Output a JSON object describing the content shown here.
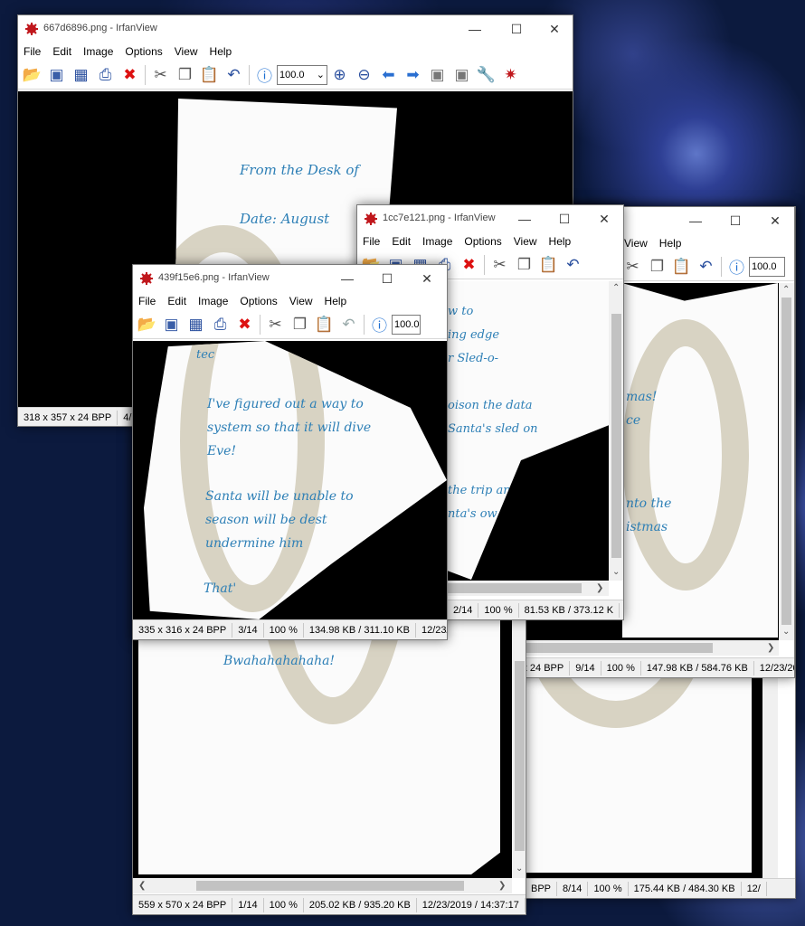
{
  "windows": {
    "w1": {
      "title": "667d6896.png - IrfanView",
      "menu": [
        "File",
        "Edit",
        "Image",
        "Options",
        "View",
        "Help"
      ],
      "zoom": "100.0",
      "text": {
        "line1": "From the Desk of",
        "line2": "Date: August"
      },
      "status": [
        "318 x 357 x 24 BPP",
        "4/14"
      ]
    },
    "w2": {
      "title": "1cc7e121.png - IrfanView",
      "menu": [
        "File",
        "Edit",
        "Image",
        "Options",
        "View",
        "Help"
      ],
      "text": {
        "l1": "w to",
        "l2": "ing edge",
        "l3": "r Sled-o-",
        "l4": "oison the data",
        "l5": "Santa's sled on",
        "l6": "the trip an",
        "l7": "nta's ow"
      },
      "status": [
        "2/14",
        "100 %",
        "81.53 KB / 373.12 K"
      ]
    },
    "w3": {
      "menu": [
        "View",
        "Help"
      ],
      "zoom": "100.0",
      "text": {
        "l1": "mas!",
        "l2": "ce",
        "l3": "nto the",
        "l4": "istmas"
      },
      "status": [
        "431 x 462 x 24 BPP",
        "9/14",
        "100 %",
        "147.98 KB / 584.76 KB",
        "12/23/20"
      ]
    },
    "w4": {
      "title": "439f15e6.png - IrfanView",
      "menu": [
        "File",
        "Edit",
        "Image",
        "Options",
        "View",
        "Help"
      ],
      "zoom": "100.0",
      "text": {
        "l0": "tec",
        "l1": "I've figured out a way to",
        "l2": "system so that it will dive",
        "l3": "Eve!",
        "l4": "Santa will be unable to",
        "l5": "season will be dest",
        "l6": "undermine him",
        "l7": "That'"
      },
      "status": [
        "335 x 316 x 24 BPP",
        "3/14",
        "100 %",
        "134.98 KB / 311.10 KB",
        "12/23/"
      ]
    },
    "w5": {
      "text": {
        "signoff": "Bwahahahahaha!"
      },
      "status": [
        "559 x 570 x 24 BPP",
        "1/14",
        "100 %",
        "205.02 KB / 935.20 KB",
        "12/23/2019 / 14:37:17"
      ]
    },
    "w6": {
      "status": [
        "BPP",
        "8/14",
        "100 %",
        "175.44 KB / 484.30 KB",
        "12/"
      ]
    }
  },
  "icons": {
    "minimize": "minimize-icon",
    "maximize": "maximize-icon",
    "close": "close-icon",
    "app": "irfanview-icon"
  },
  "colors": {
    "ink": "#2d7fb6",
    "paper": "#fbfbfb",
    "accent_red": "#c0171c"
  }
}
